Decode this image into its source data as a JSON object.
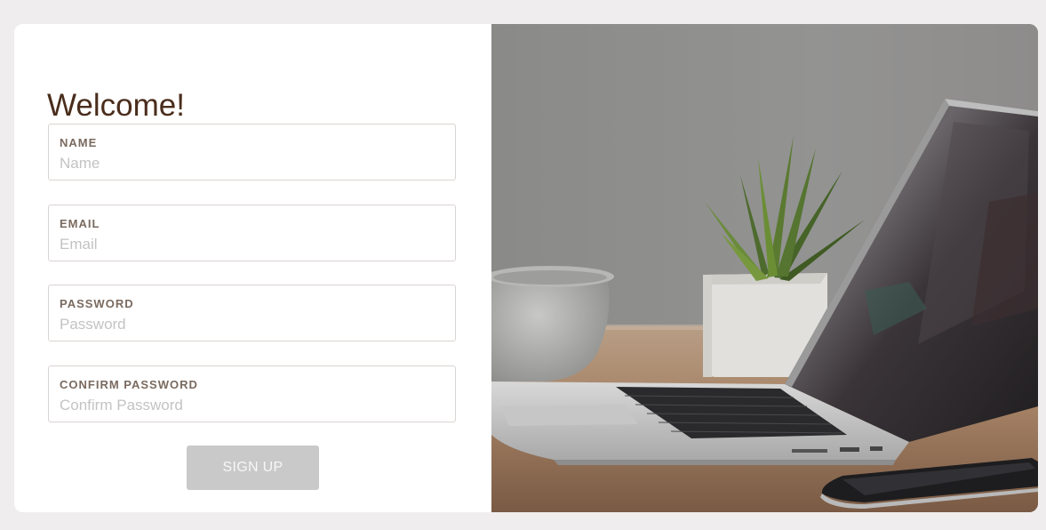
{
  "form": {
    "title": "Welcome!",
    "fields": [
      {
        "label": "NAME",
        "placeholder": "Name",
        "value": ""
      },
      {
        "label": "EMAIL",
        "placeholder": "Email",
        "value": ""
      },
      {
        "label": "PASSWORD",
        "placeholder": "Password",
        "value": ""
      },
      {
        "label": "CONFIRM PASSWORD",
        "placeholder": "Confirm Password",
        "value": ""
      }
    ],
    "submit_label": "SIGN UP"
  },
  "hero_image": {
    "subject": "laptop-desk-photo"
  },
  "colors": {
    "page_background": "#efeded",
    "title": "#4a2d1c",
    "label": "#7a6a5f",
    "button_disabled": "#c9c9c9"
  }
}
